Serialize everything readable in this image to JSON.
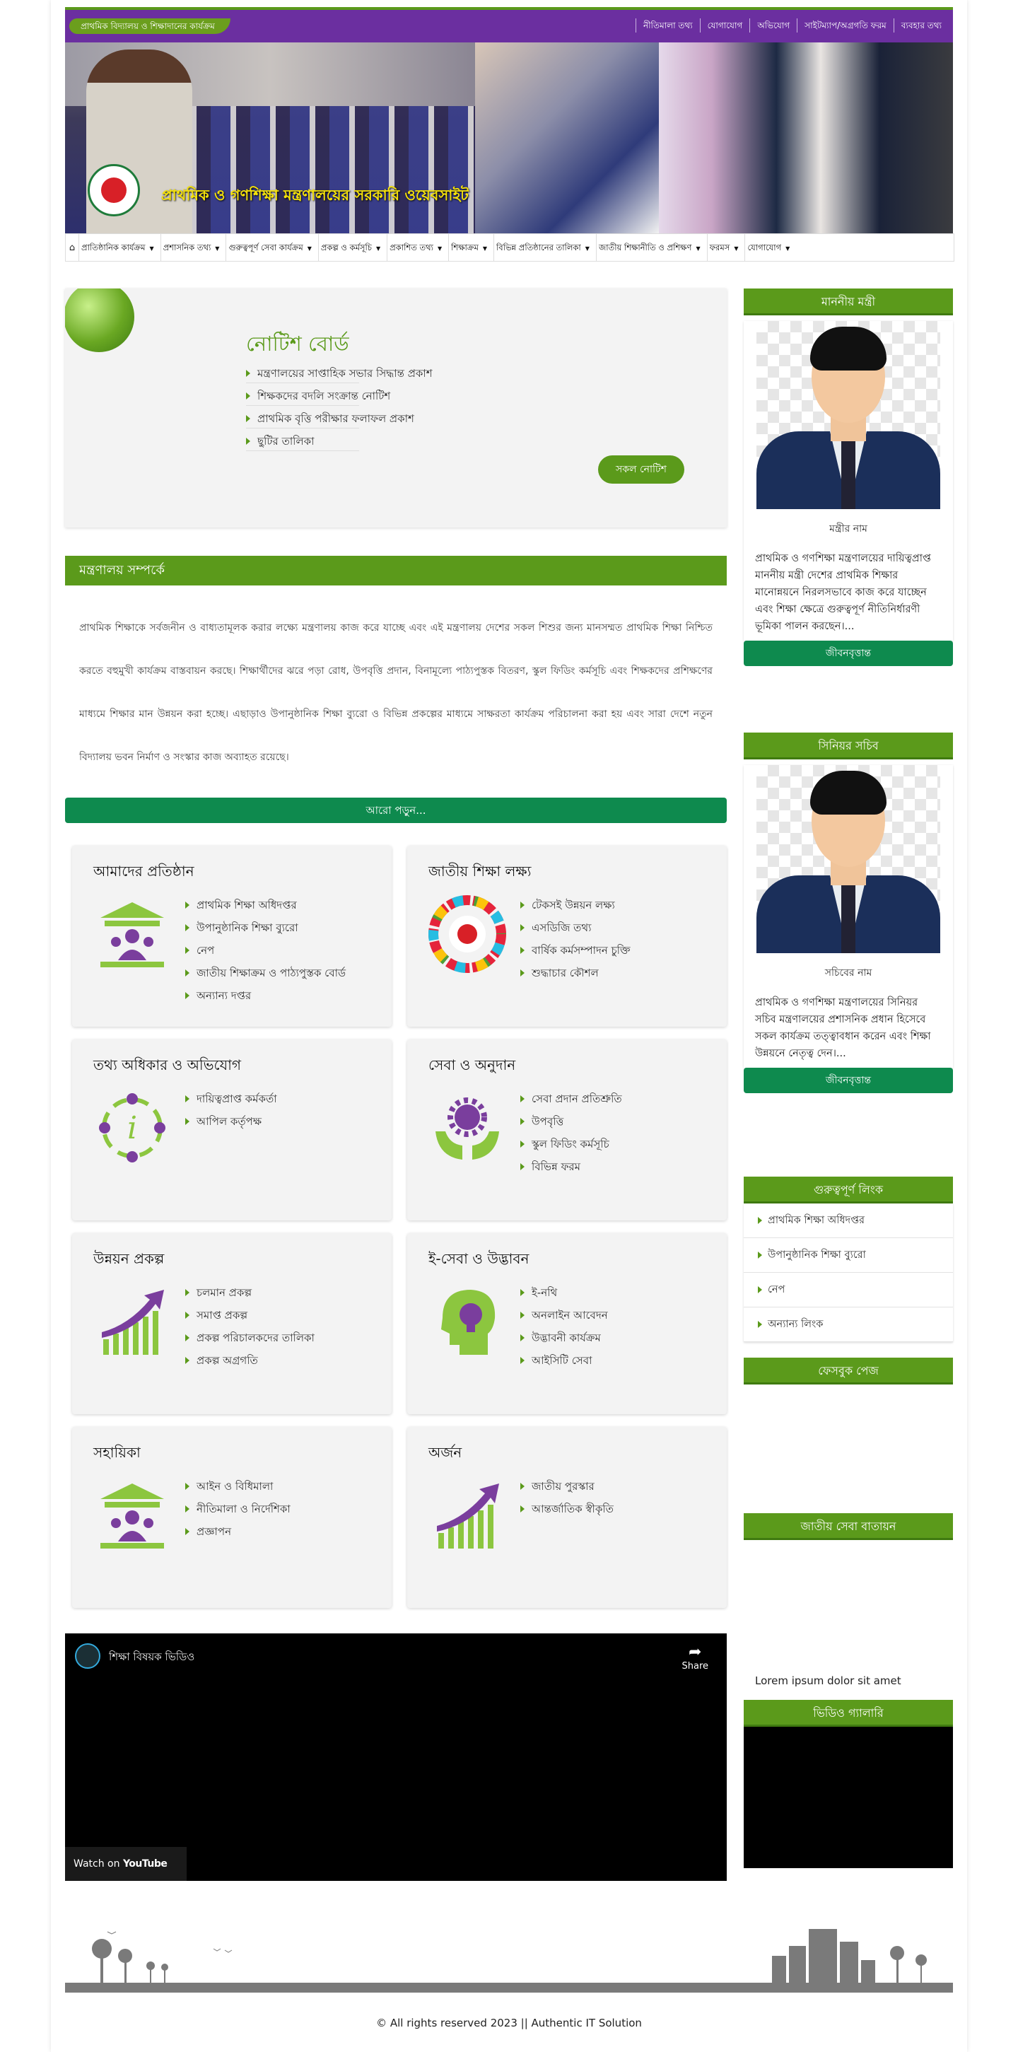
{
  "topbar": {
    "badge": "প্রাথমিক বিদ্যালয় ও শিক্ষাদানের কার্যক্রম",
    "links": [
      "নীতিমালা তথ্য",
      "যোগাযোগ",
      "অভিযোগ",
      "সাইটম্যাপ/অগ্রগতি ফরম",
      "ব্যবহার তথ্য"
    ]
  },
  "banner": {
    "title": "প্রাথমিক ও গণশিক্ষা মন্ত্রণালয়ের সরকারি ওয়েবসাইট"
  },
  "nav": {
    "items": [
      "প্রাতিষ্ঠানিক কার্যক্রম",
      "প্রশাসনিক তথ্য",
      "গুরুত্বপূর্ণ সেবা কার্যক্রম",
      "প্রকল্প ও কর্মসূচি",
      "প্রকাশিত তথ্য",
      "শিক্ষাক্রম",
      "বিভিন্ন প্রতিষ্ঠানের তালিকা",
      "জাতীয় শিক্ষানীতি ও প্রশিক্ষণ",
      "ফরমস",
      "যোগাযোগ"
    ]
  },
  "notice": {
    "title": "নোটিশ বোর্ড",
    "items": [
      "মন্ত্রণালয়ের সাপ্তাহিক সভার সিদ্ধান্ত প্রকাশ",
      "শিক্ষকদের বদলি সংক্রান্ত নোটিশ",
      "প্রাথমিক বৃত্তি পরীক্ষার ফলাফল প্রকাশ",
      "ছুটির তালিকা"
    ],
    "all_button": "সকল নোটিশ"
  },
  "about": {
    "title": "মন্ত্রণালয় সম্পর্কে",
    "body": "প্রাথমিক শিক্ষাকে সর্বজনীন ও বাধ্যতামূলক করার লক্ষ্যে মন্ত্রণালয় কাজ করে যাচ্ছে এবং এই মন্ত্রণালয় দেশের সকল শিশুর জন্য মানসম্মত প্রাথমিক শিক্ষা নিশ্চিত করতে বহুমুখী কার্যক্রম বাস্তবায়ন করছে। শিক্ষার্থীদের ঝরে পড়া রোধ, উপবৃত্তি প্রদান, বিনামূল্যে পাঠ্যপুস্তক বিতরণ, স্কুল ফিডিং কর্মসূচি এবং শিক্ষকদের প্রশিক্ষণের মাধ্যমে শিক্ষার মান উন্নয়ন করা হচ্ছে। এছাড়াও উপানুষ্ঠানিক শিক্ষা ব্যুরো ও বিভিন্ন প্রকল্পের মাধ্যমে সাক্ষরতা কার্যক্রম পরিচালনা করা হয় এবং সারা দেশে নতুন বিদ্যালয় ভবন নির্মাণ ও সংস্কার কাজ অব্যাহত রয়েছে।",
    "more": "আরো পড়ুন..."
  },
  "services": [
    {
      "title": "আমাদের প্রতিষ্ঠান",
      "items": [
        "প্রাথমিক শিক্ষা অধিদপ্তর",
        "উপানুষ্ঠানিক শিক্ষা ব্যুরো",
        "নেপ",
        "জাতীয় শিক্ষাক্রম ও পাঠ্যপুস্তক বোর্ড",
        "অন্যান্য দপ্তর"
      ]
    },
    {
      "title": "জাতীয় শিক্ষা লক্ষ্য",
      "items": [
        "টেকসই উন্নয়ন লক্ষ্য",
        "এসডিজি তথ্য",
        "বার্ষিক কর্মসম্পাদন চুক্তি",
        "শুদ্ধাচার কৌশল"
      ]
    },
    {
      "title": "তথ্য অধিকার ও অভিযোগ",
      "items": [
        "দায়িত্বপ্রাপ্ত কর্মকর্তা",
        "আপিল কর্তৃপক্ষ"
      ]
    },
    {
      "title": "সেবা ও অনুদান",
      "items": [
        "সেবা প্রদান প্রতিশ্রুতি",
        "উপবৃত্তি",
        "স্কুল ফিডিং কর্মসূচি",
        "বিভিন্ন ফরম"
      ]
    },
    {
      "title": "উন্নয়ন প্রকল্প",
      "items": [
        "চলমান প্রকল্প",
        "সমাপ্ত প্রকল্প",
        "প্রকল্প পরিচালকদের তালিকা",
        "প্রকল্প অগ্রগতি"
      ]
    },
    {
      "title": "ই-সেবা ও উদ্ভাবন",
      "items": [
        "ই-নথি",
        "অনলাইন আবেদন",
        "উদ্ভাবনী কার্যক্রম",
        "আইসিটি সেবা"
      ]
    },
    {
      "title": "সহায়িকা",
      "items": [
        "আইন ও বিধিমালা",
        "নীতিমালা ও নির্দেশিকা",
        "প্রজ্ঞাপন"
      ]
    },
    {
      "title": "অর্জন",
      "items": [
        "জাতীয় পুরস্কার",
        "আন্তর্জাতিক স্বীকৃতি"
      ]
    }
  ],
  "video": {
    "title": "শিক্ষা বিষয়ক ভিডিও",
    "share": "Share",
    "watch_on": "Watch on",
    "youtube": "YouTube"
  },
  "sidebar": {
    "minister": {
      "heading": "মাননীয় মন্ত্রী",
      "name": "মন্ত্রীর নাম",
      "bio": "প্রাথমিক ও গণশিক্ষা মন্ত্রণালয়ের দায়িত্বপ্রাপ্ত মাননীয় মন্ত্রী দেশের প্রাথমিক শিক্ষার মানোন্নয়নে নিরলসভাবে কাজ করে যাচ্ছেন এবং শিক্ষা ক্ষেত্রে গুরুত্বপূর্ণ নীতিনির্ধারণী ভূমিকা পালন করছেন।...",
      "button": "জীবনবৃত্তান্ত"
    },
    "secretary": {
      "heading": "সিনিয়র সচিব",
      "name": "সচিবের নাম",
      "bio": "প্রাথমিক ও গণশিক্ষা মন্ত্রণালয়ের সিনিয়র সচিব মন্ত্রণালয়ের প্রশাসনিক প্রধান হিসেবে সকল কার্যক্রম তত্ত্বাবধান করেন এবং শিক্ষা উন্নয়নে নেতৃত্ব দেন।...",
      "button": "জীবনবৃত্তান্ত"
    },
    "links_heading": "গুরুত্বপূর্ণ লিংক",
    "links": [
      "প্রাথমিক শিক্ষা অধিদপ্তর",
      "উপানুষ্ঠানিক শিক্ষা ব্যুরো",
      "নেপ",
      "অন্যান্য লিংক"
    ],
    "facebook_heading": "ফেসবুক পেজ",
    "calendar_heading": "জাতীয় সেবা বাতায়ন",
    "lorem": "Lorem ipsum dolor sit amet",
    "video_heading": "ভিডিও গ্যালারি"
  },
  "footer": {
    "copyright": "© All rights reserved 2023 || Authentic IT Solution"
  },
  "colors": {
    "primary_green": "#5b9a1b",
    "purple": "#6b2fa0",
    "dark_green": "#0e8a4e",
    "banner_title": "#f5e20a"
  }
}
